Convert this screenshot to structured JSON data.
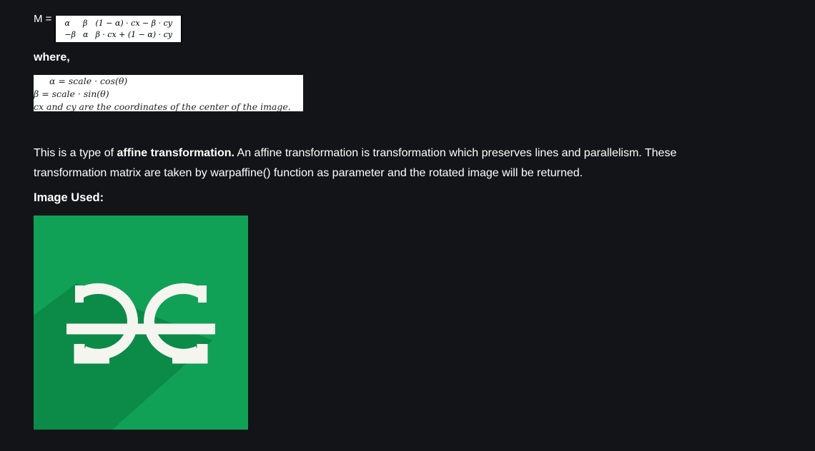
{
  "formula": {
    "label": "M =",
    "matrix": [
      [
        "α",
        "β",
        "(1 − α) · cx − β · cy"
      ],
      [
        "−β",
        "α",
        "β · cx + (1 − α) · cy"
      ]
    ]
  },
  "where_label": "where,",
  "definitions": [
    "α = scale · cos(θ)",
    "β = scale · sin(θ)",
    "cx and cy are the coordinates of the center of the image."
  ],
  "paragraph": {
    "part1": "This is a type of ",
    "bold": "affine transformation.",
    "part2": " An affine transformation is transformation which preserves lines and parallelism. These transformation matrix are taken by warpaffine() function as parameter and the rotated image will be returned."
  },
  "image_used_label": "Image Used:",
  "logo": {
    "background": "#10a156",
    "shadow": "#0c8a48",
    "letters_color": "#f5f5f0"
  }
}
